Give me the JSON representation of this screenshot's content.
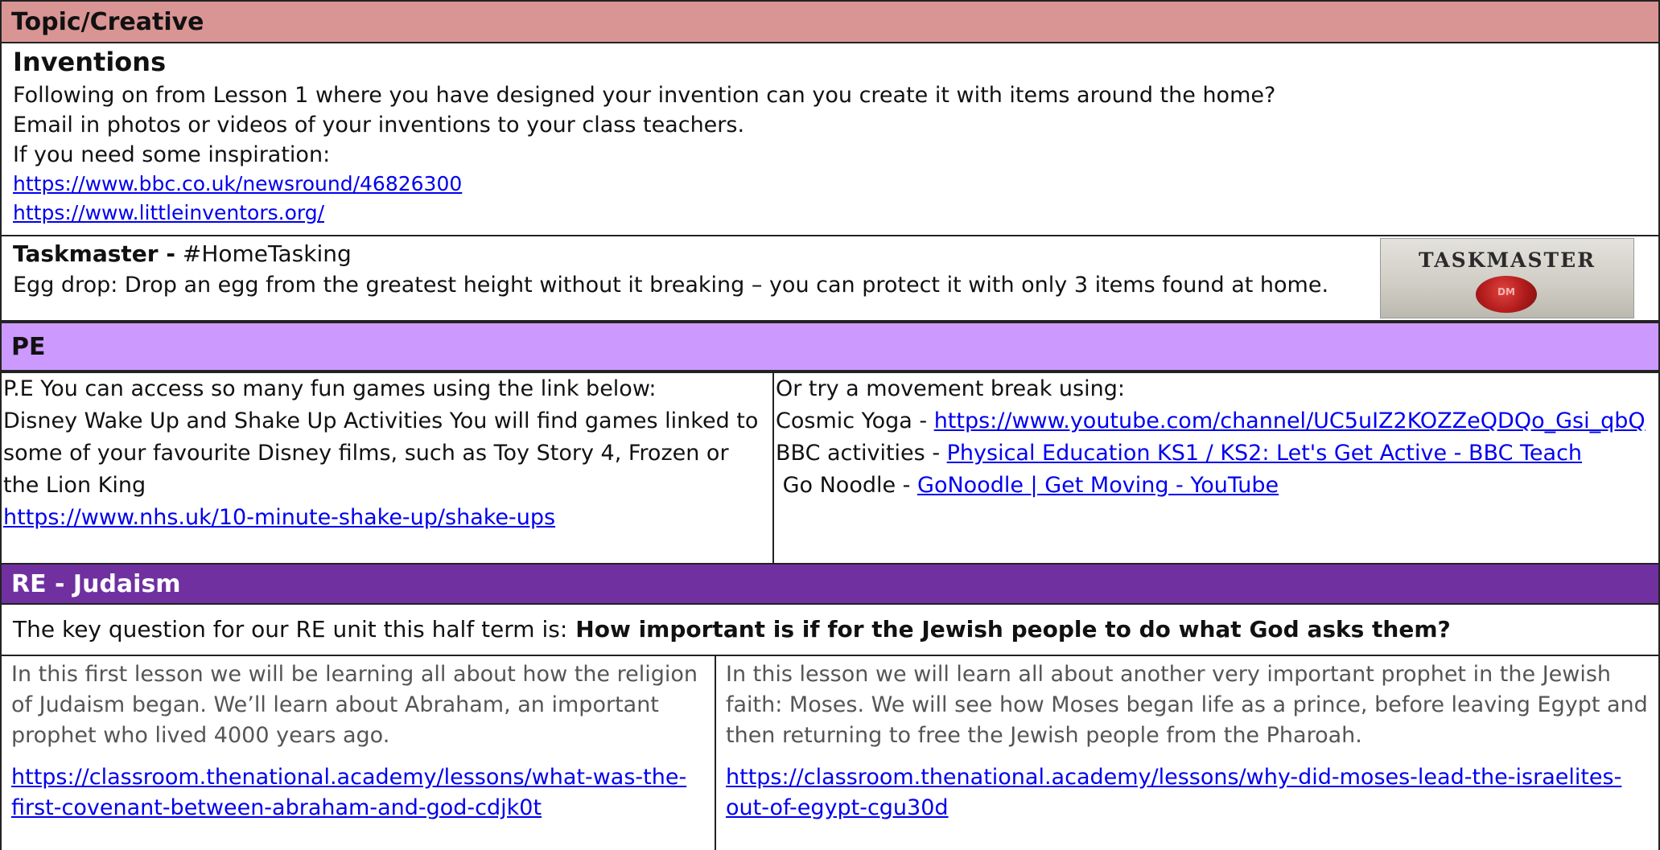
{
  "topic": {
    "header": "Topic/Creative",
    "title": "Inventions",
    "lines": [
      "Following on from Lesson 1 where you have designed your invention can you create it with items around the home?",
      "Email in photos or videos of your inventions to your class teachers.",
      "If you need some inspiration:"
    ],
    "links": [
      "https://www.bbc.co.uk/newsround/46826300",
      "https://www.littleinventors.org/"
    ],
    "taskmaster": {
      "title": "Taskmaster -",
      "hashtag": "#HomeTasking",
      "text": "Egg drop: Drop an egg from the greatest height without it breaking – you can protect it with only 3 items found at home.",
      "logo_word": "TASKMASTER",
      "seal_text": "DM"
    }
  },
  "pe": {
    "header": "PE",
    "left_lines": [
      "P.E You can access so many fun games using the link below:",
      "Disney Wake Up and Shake Up Activities You will find games linked to some of your favourite Disney films, such as Toy Story 4, Frozen or the Lion King"
    ],
    "left_link": "https://www.nhs.uk/10-minute-shake-up/shake-ups",
    "right_intro": "Or try a movement break using:",
    "right_items": [
      {
        "label": "Cosmic Yoga - ",
        "link": "https://www.youtube.com/channel/UC5uIZ2KOZZeQDQo_Gsi_qbQ"
      },
      {
        "label": "BBC activities - ",
        "link": "Physical Education KS1 / KS2: Let's Get Active - BBC Teach"
      },
      {
        "label": " Go Noodle - ",
        "link": "GoNoodle | Get Moving - YouTube"
      }
    ]
  },
  "re": {
    "header": "RE - Judaism",
    "question_prefix": "The key question for our RE unit this half term is:",
    "question_bold": "How important is if for the Jewish people to do what God asks them?",
    "left_text": "In this first lesson we will be learning all about how the religion of Judaism began. We’ll learn about Abraham, an important prophet who lived 4000 years ago.",
    "left_link": "https://classroom.thenational.academy/lessons/what-was-the-first-covenant-between-abraham-and-god-cdjk0t",
    "right_text": "In this lesson we will learn all about another very important prophet in the Jewish faith: Moses. We will see how Moses began life as a prince, before leaving Egypt and then returning to free the Jewish people from the Pharoah.",
    "right_link": "https://classroom.thenational.academy/lessons/why-did-moses-lead-the-israelites-out-of-egypt-cgu30d"
  },
  "colors": {
    "topic_header": "#d99594",
    "pe_header": "#cc99ff",
    "re_header": "#7030a0"
  }
}
